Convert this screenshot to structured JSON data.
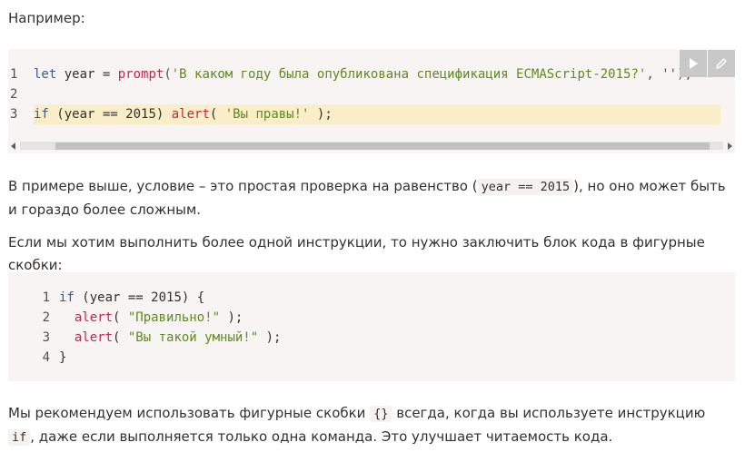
{
  "intro": "Например:",
  "code1": {
    "line_numbers": [
      "1",
      "2",
      "3"
    ],
    "line1": {
      "kw": "let",
      "ident": " year = ",
      "fn": "prompt",
      "open": "(",
      "str": "'В каком году была опубликована спецификация ECMAScript-2015?'",
      "rest": ", '');"
    },
    "line3": {
      "kw": "if",
      "cond_a": " (year == ",
      "num": "2015",
      "cond_b": ") ",
      "fn": "alert",
      "open": "( ",
      "str": "'Вы правы!'",
      "close": " );"
    },
    "tools": {
      "run": "run-icon",
      "edit": "pencil-icon"
    }
  },
  "para1": {
    "a": "В примере выше, условие – это простая проверка на равенство (",
    "code": "year == 2015",
    "b": "), но оно может быть и гораздо более сложным."
  },
  "para2": "Если мы хотим выполнить более одной инструкции, то нужно заключить блок кода в фигурные скобки:",
  "code2": {
    "line_numbers": [
      "1",
      "2",
      "3",
      "4"
    ],
    "l1": {
      "kw": "if",
      "a": " (year == ",
      "num": "2015",
      "b": ") {"
    },
    "l2": {
      "indent": "  ",
      "fn": "alert",
      "open": "( ",
      "str": "\"Правильно!\"",
      "close": " );"
    },
    "l3": {
      "indent": "  ",
      "fn": "alert",
      "open": "( ",
      "str": "\"Вы такой умный!\"",
      "close": " );"
    },
    "l4": "}"
  },
  "para3": {
    "a": "Мы рекомендуем использовать фигурные скобки ",
    "code1": "{}",
    "b": " всегда, когда вы используете инструкцию ",
    "code2": "if",
    "c": ", даже если выполняется только одна команда. Это улучшает читаемость кода."
  }
}
